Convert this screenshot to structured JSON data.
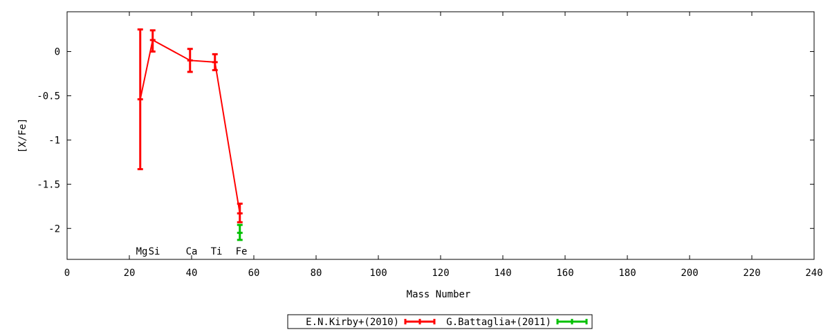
{
  "chart_data": {
    "type": "line",
    "xlabel": "Mass Number",
    "ylabel": "[X/Fe]",
    "xlim": [
      0,
      240
    ],
    "ylim": [
      -2.35,
      0.45
    ],
    "xticks": [
      0,
      20,
      40,
      60,
      80,
      100,
      120,
      140,
      160,
      180,
      200,
      220,
      240
    ],
    "yticks": [
      0,
      -0.5,
      -1,
      -1.5,
      -2
    ],
    "ytick_labels": [
      "0",
      "-0.5",
      "-1",
      "-1.5",
      "-2"
    ],
    "grid": false,
    "legend_position": "bottom-center",
    "element_labels": [
      {
        "text": "Mg",
        "x": 24
      },
      {
        "text": "Si",
        "x": 28
      },
      {
        "text": "Ca",
        "x": 40
      },
      {
        "text": "Ti",
        "x": 48
      },
      {
        "text": "Fe",
        "x": 56
      }
    ],
    "series": [
      {
        "name": "E.N.Kirby+(2010)",
        "color": "#ff0000",
        "x": [
          23.5,
          27.5,
          39.5,
          47.5,
          55.5
        ],
        "y": [
          -0.54,
          0.13,
          -0.1,
          -0.12,
          -1.83
        ],
        "err_low": [
          -1.33,
          0.0,
          -0.23,
          -0.21,
          -1.93
        ],
        "err_high": [
          0.25,
          0.24,
          0.03,
          -0.03,
          -1.72
        ]
      },
      {
        "name": "G.Battaglia+(2011)",
        "color": "#00c000",
        "x": [
          55.5
        ],
        "y": [
          -2.05
        ],
        "err_low": [
          -2.13
        ],
        "err_high": [
          -1.96
        ]
      }
    ]
  }
}
